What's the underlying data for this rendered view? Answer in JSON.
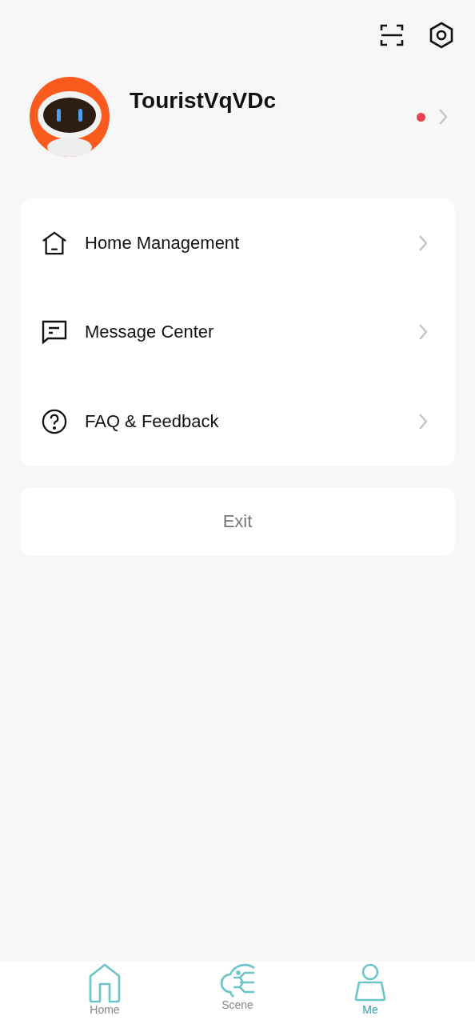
{
  "profile": {
    "name": "TouristVqVDc",
    "unread": true
  },
  "menu": [
    {
      "kind": "house",
      "label": "Home Management"
    },
    {
      "kind": "message",
      "label": "Message Center"
    },
    {
      "kind": "help",
      "label": "FAQ & Feedback"
    }
  ],
  "exit": {
    "label": "Exit"
  },
  "tabs": [
    {
      "kind": "home",
      "label": "Home",
      "selected": false
    },
    {
      "kind": "scene",
      "label": "Scene",
      "selected": false
    },
    {
      "kind": "me",
      "label": "Me",
      "selected": true
    }
  ]
}
